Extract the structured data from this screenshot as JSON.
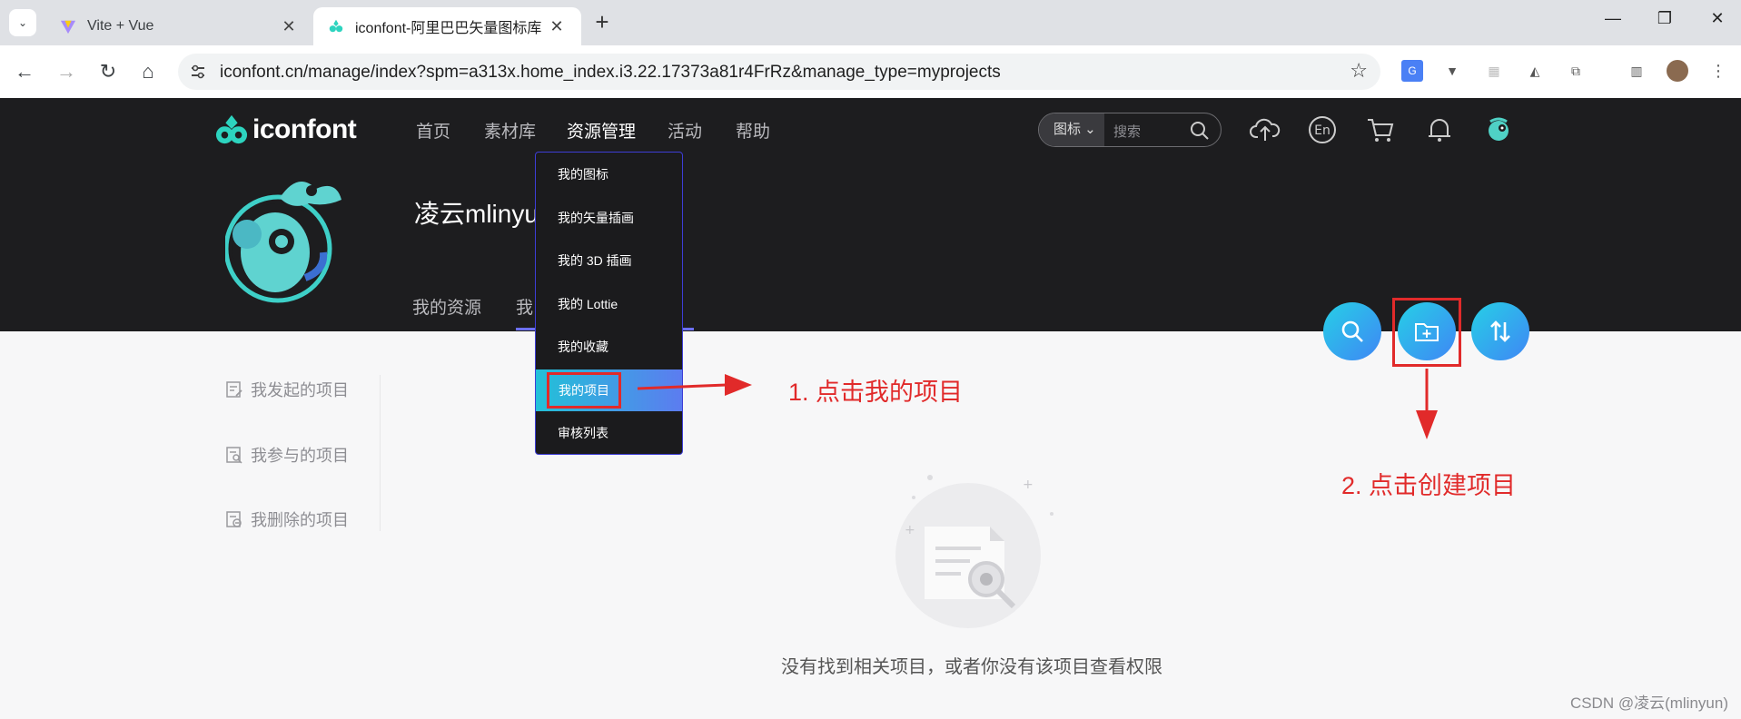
{
  "browser": {
    "tabs": [
      {
        "title": "Vite + Vue",
        "active": false
      },
      {
        "title": "iconfont-阿里巴巴矢量图标库",
        "active": true
      }
    ],
    "url": "iconfont.cn/manage/index?spm=a313x.home_index.i3.22.17373a81r4FrRz&manage_type=myprojects"
  },
  "site": {
    "logo_text": "iconfont",
    "nav": [
      "首页",
      "素材库",
      "资源管理",
      "活动",
      "帮助"
    ],
    "active_nav": "资源管理",
    "search": {
      "type": "图标",
      "placeholder": "搜索"
    },
    "username": "凌云mlinyu",
    "profile_tabs": [
      "我的资源",
      "我"
    ]
  },
  "dropdown": {
    "items": [
      "我的图标",
      "我的矢量插画",
      "我的 3D 插画",
      "我的 Lottie",
      "我的收藏",
      "我的项目",
      "审核列表"
    ],
    "selected": "我的项目"
  },
  "sidebar": {
    "items": [
      "我发起的项目",
      "我参与的项目",
      "我删除的项目"
    ]
  },
  "empty_state": {
    "text": "没有找到相关项目，或者你没有该项目查看权限"
  },
  "annotations": {
    "step1": "1. 点击我的项目",
    "step2": "2. 点击创建项目"
  },
  "colors": {
    "annotation_red": "#e12a2a",
    "header_bg": "#1d1d1f",
    "accent_gradient_start": "#22c1d8",
    "accent_gradient_end": "#5c7cf0"
  },
  "watermark": "CSDN @凌云(mlinyun)"
}
